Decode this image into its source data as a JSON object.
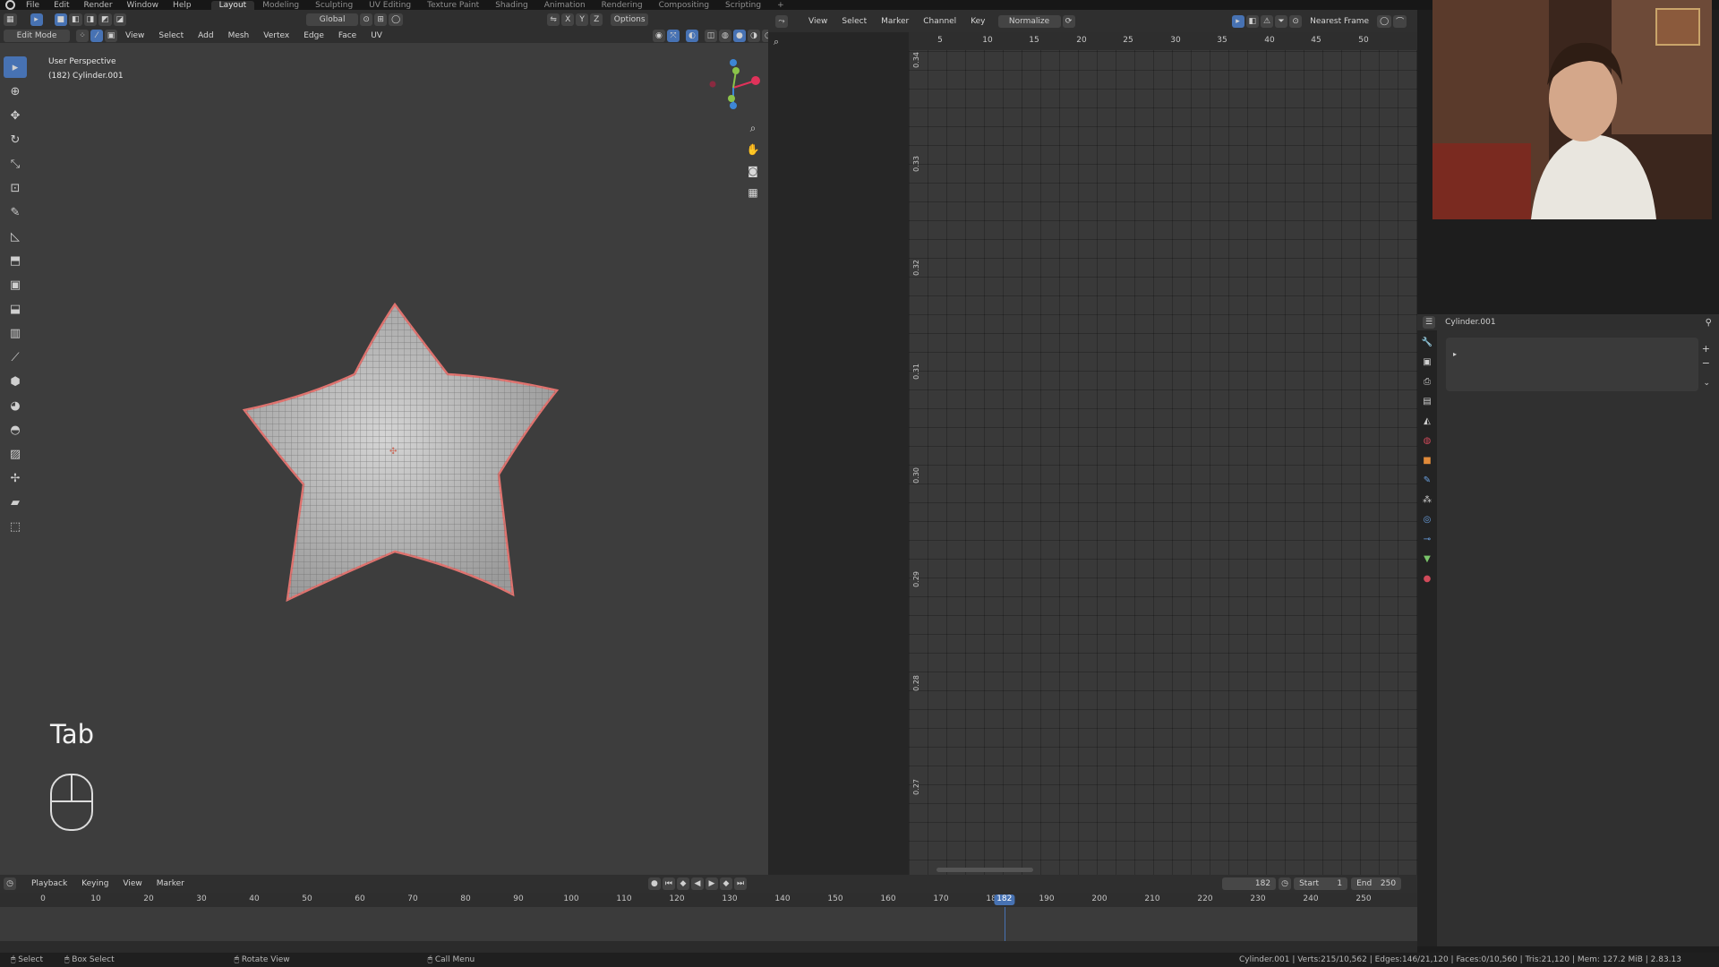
{
  "topbar": {
    "menus": [
      "File",
      "Edit",
      "Render",
      "Window",
      "Help"
    ],
    "workspaces": [
      "Layout",
      "Modeling",
      "Sculpting",
      "UV Editing",
      "Texture Paint",
      "Shading",
      "Animation",
      "Rendering",
      "Compositing",
      "Scripting"
    ],
    "add_tab": "+"
  },
  "viewport": {
    "mode": "Edit Mode",
    "menus": [
      "View",
      "Select",
      "Add",
      "Mesh",
      "Vertex",
      "Edge",
      "Face",
      "UV"
    ],
    "orientation": "Global",
    "options_label": "Options",
    "axes": [
      "X",
      "Y",
      "Z"
    ],
    "view_name": "User Perspective",
    "object_info": "(182) Cylinder.001",
    "key_overlay": "Tab"
  },
  "graph_editor": {
    "menus": [
      "View",
      "Select",
      "Marker",
      "Channel",
      "Key"
    ],
    "normalize_label": "Normalize",
    "snap_mode": "Nearest Frame",
    "x_ticks": [
      "5",
      "10",
      "15",
      "20",
      "25",
      "30",
      "35",
      "40",
      "45",
      "50"
    ],
    "y_ticks": [
      "0.34",
      "0.33",
      "0.32",
      "0.31",
      "0.30",
      "0.29",
      "0.28",
      "0.27"
    ]
  },
  "properties": {
    "object_name": "Cylinder.001"
  },
  "timeline": {
    "menus": [
      "Playback",
      "Keying",
      "View",
      "Marker"
    ],
    "current_frame": "182",
    "start_label": "Start",
    "start_value": "1",
    "end_label": "End",
    "end_value": "250",
    "ticks": [
      "0",
      "10",
      "20",
      "30",
      "40",
      "50",
      "60",
      "70",
      "80",
      "90",
      "100",
      "110",
      "120",
      "130",
      "140",
      "150",
      "160",
      "170",
      "180",
      "190",
      "200",
      "210",
      "220",
      "230",
      "240",
      "250"
    ]
  },
  "statusbar": {
    "select": "Select",
    "box_select": "Box Select",
    "rotate_view": "Rotate View",
    "call_menu": "Call Menu",
    "stats": "Cylinder.001 | Verts:215/10,562 | Edges:146/21,120 | Faces:0/10,560 | Tris:21,120 | Mem: 127.2 MiB | 2.83.13"
  },
  "colors": {
    "accent": "#4772b3",
    "mesh_edge": "#e0736f",
    "gizmo_x": "#e0325a",
    "gizmo_y": "#8bc34a",
    "gizmo_z": "#3d86d6"
  }
}
